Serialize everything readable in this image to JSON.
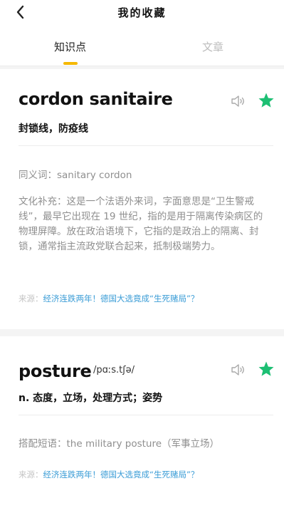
{
  "header": {
    "title": "我的收藏"
  },
  "tabs": [
    {
      "label": "知识点",
      "active": true
    },
    {
      "label": "文章",
      "active": false
    }
  ],
  "colors": {
    "accent": "#f5b800",
    "star": "#1dbf73",
    "link": "#3a9cd6"
  },
  "cards": [
    {
      "word": "cordon sanitaire",
      "meaning": "封锁线，防疫线",
      "synonym": "同义词：sanitary cordon",
      "note": "文化补充：这是一个法语外来词，字面意思是“卫生警戒线”，最早它出现在 19 世纪，指的是用于隔离传染病区的物理屏障。放在政治语境下，它指的是政治上的隔离、封锁，通常指主流政党联合起来，抵制极端势力。",
      "source_label": "来源：",
      "source_link": "经济连跌两年！德国大选竟成“生死赌局”？",
      "icons": [
        "speaker-icon",
        "star-icon"
      ]
    },
    {
      "word": "posture",
      "phonetic": "/pɑːs.tʃə/",
      "meaning": "n. 态度，立场，处理方式；姿势",
      "collocation": "搭配短语：the military posture（军事立场）",
      "source_label": "来源：",
      "source_link": "经济连跌两年！德国大选竟成“生死赌局”？",
      "icons": [
        "speaker-icon",
        "star-icon"
      ]
    }
  ]
}
